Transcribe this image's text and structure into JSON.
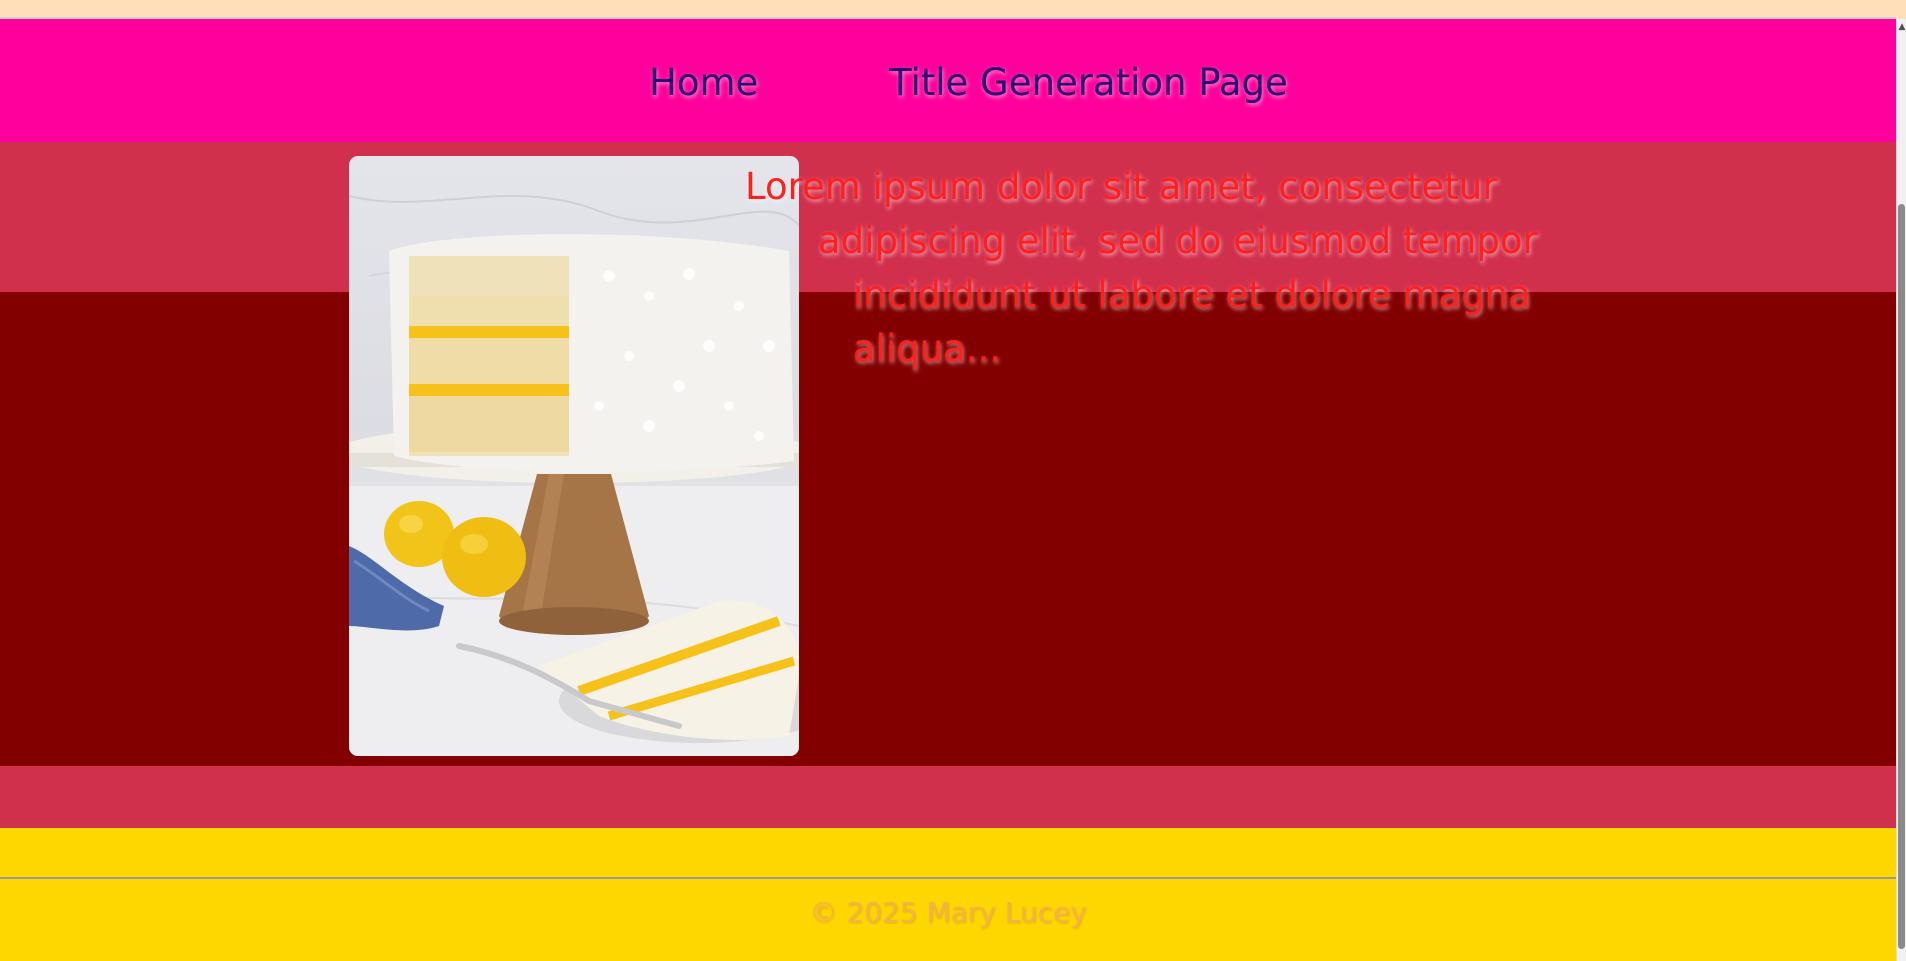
{
  "nav": {
    "items": [
      {
        "label": "Home"
      },
      {
        "label": "Title Generation Page"
      }
    ]
  },
  "content": {
    "image_alt": "Coconut layer cake with lemon curd on a cake stand",
    "text_lines": [
      "Lorem ipsum dolor sit amet, consectetur",
      "adipiscing elit, sed do eiusmod tempor",
      "incididunt ut labore et dolore magna",
      "aliqua..."
    ]
  },
  "footer": {
    "copyright": "© 2025 Mary Lucey"
  },
  "colors": {
    "page_background": "#ffdfba",
    "nav_background": "#ff009c",
    "nav_text": "#2c006e",
    "band_light": "#d1304d",
    "band_dark": "#820000",
    "footer_background": "#ffd700",
    "footer_text": "#f4b34a",
    "body_text": "#ff1f1f"
  },
  "icons": {
    "scroll_up": "scroll-up-arrow-icon"
  }
}
